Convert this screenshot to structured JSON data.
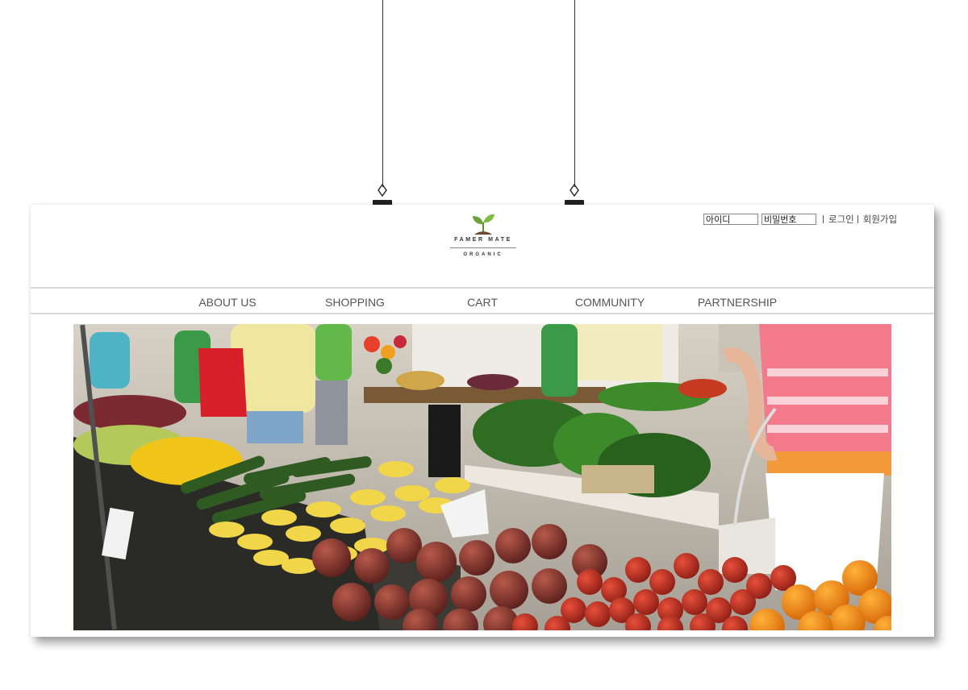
{
  "logo": {
    "brand": "FAMER MATE",
    "sub": "ORGANIC"
  },
  "login": {
    "id_placeholder": "아이디",
    "password_placeholder": "비밀번호",
    "login_label": "로그인",
    "signup_label": "회원가입"
  },
  "nav": {
    "items": [
      {
        "label": "ABOUT US"
      },
      {
        "label": "SHOPPING"
      },
      {
        "label": "CART"
      },
      {
        "label": "COMMUNITY"
      },
      {
        "label": "PARTNERSHIP"
      }
    ]
  },
  "colors": {
    "nav_text": "#555555",
    "logo_leaf": "#6aa43a",
    "shadow": "#8a8a8a"
  },
  "hero": {
    "image": "farmers-market-produce-stand"
  }
}
